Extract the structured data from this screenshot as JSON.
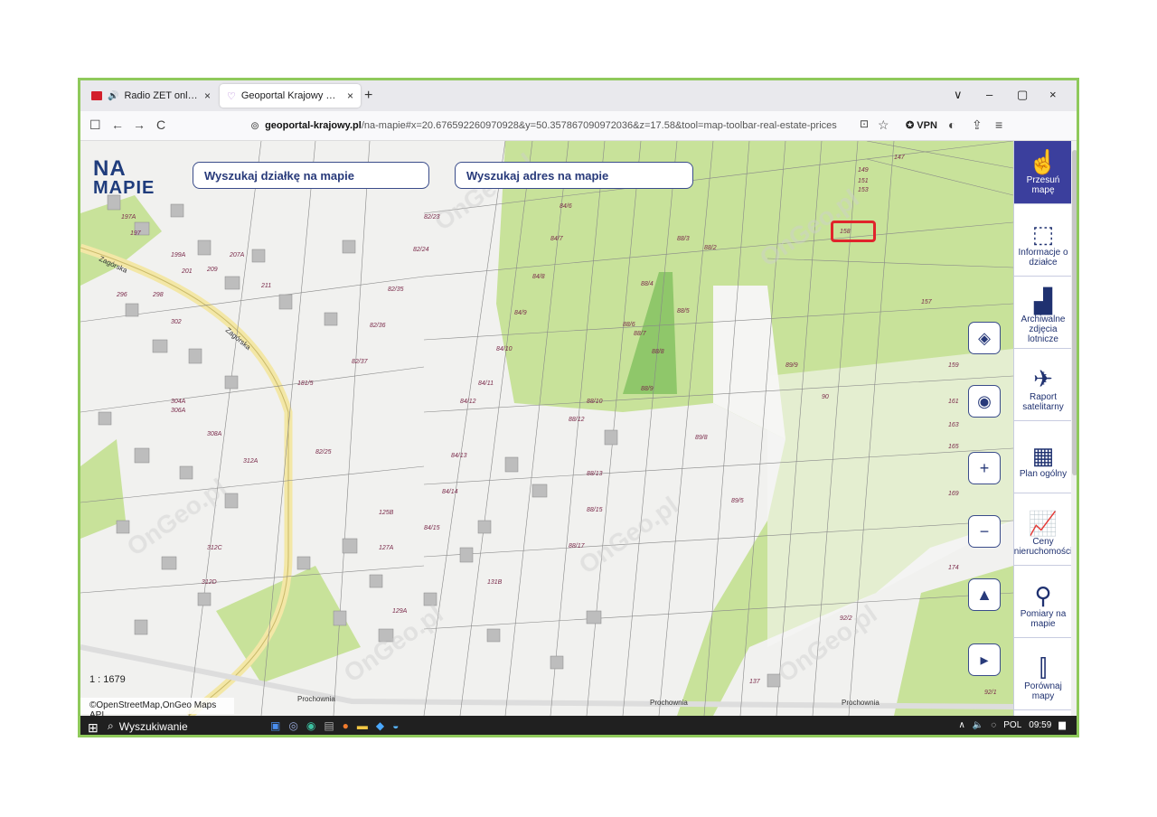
{
  "browser": {
    "tabs": [
      {
        "title": "Radio ZET online - muzyczn",
        "close": "×"
      },
      {
        "title": "Geoportal Krajowy mapy i infor",
        "close": "×"
      }
    ],
    "new_tab": "+",
    "window_controls": [
      "∨",
      "–",
      "▢",
      "×"
    ],
    "nav_icons": [
      "☐",
      "←",
      "→",
      "C"
    ],
    "url_domain": "geoportal-krajowy.pl",
    "url_path": "/na-mapie#x=20.676592260970928&y=50.357867090972036&z=17.58&tool=map-toolbar-real-estate-prices",
    "vpn": "VPN",
    "menu_icon": "≡"
  },
  "map": {
    "logo_line1": "NA",
    "logo_line2": "MAPIE",
    "search_parcel": "Wyszukaj działkę na mapie",
    "search_address": "Wyszukaj adres na mapie",
    "scale": "1 : 1679",
    "attribution": "©OpenStreetMap,OnGeo Maps API",
    "watermark": "OnGeo.pl",
    "highlighted_parcel": "158",
    "controls": [
      "◈",
      "◉",
      "+",
      "−",
      "▲",
      "▸"
    ],
    "colors": {
      "green": "#c8e29a",
      "dark_green": "#8fc76a",
      "highlight": "#e0242b",
      "road": "#f3e7a6"
    },
    "parcel_labels": [
      {
        "t": "158"
      },
      {
        "t": "157"
      },
      {
        "t": "159"
      },
      {
        "t": "161"
      },
      {
        "t": "163"
      },
      {
        "t": "165"
      },
      {
        "t": "169"
      },
      {
        "t": "174"
      },
      {
        "t": "147"
      },
      {
        "t": "149"
      },
      {
        "t": "151"
      },
      {
        "t": "153"
      },
      {
        "t": "89/8"
      },
      {
        "t": "89/9"
      },
      {
        "t": "89/5"
      },
      {
        "t": "88/3"
      },
      {
        "t": "88/2"
      },
      {
        "t": "88/4"
      },
      {
        "t": "88/5"
      },
      {
        "t": "88/6"
      },
      {
        "t": "88/7"
      },
      {
        "t": "88/8"
      },
      {
        "t": "88/9"
      },
      {
        "t": "88/10"
      },
      {
        "t": "88/12"
      },
      {
        "t": "88/13"
      },
      {
        "t": "88/15"
      },
      {
        "t": "88/17"
      },
      {
        "t": "84/6"
      },
      {
        "t": "84/7"
      },
      {
        "t": "84/8"
      },
      {
        "t": "84/9"
      },
      {
        "t": "84/10"
      },
      {
        "t": "84/11"
      },
      {
        "t": "84/12"
      },
      {
        "t": "84/13"
      },
      {
        "t": "84/14"
      },
      {
        "t": "84/15"
      },
      {
        "t": "82/23"
      },
      {
        "t": "82/24"
      },
      {
        "t": "82/35"
      },
      {
        "t": "82/36"
      },
      {
        "t": "82/37"
      },
      {
        "t": "82/25"
      },
      {
        "t": "181/5"
      },
      {
        "t": "125B"
      },
      {
        "t": "127A"
      },
      {
        "t": "129A"
      },
      {
        "t": "131B"
      },
      {
        "t": "306A"
      },
      {
        "t": "308A"
      },
      {
        "t": "312A"
      },
      {
        "t": "312C"
      },
      {
        "t": "312D"
      },
      {
        "t": "197"
      },
      {
        "t": "197A"
      },
      {
        "t": "199A"
      },
      {
        "t": "201"
      },
      {
        "t": "207A"
      },
      {
        "t": "209"
      },
      {
        "t": "211"
      },
      {
        "t": "296"
      },
      {
        "t": "298"
      },
      {
        "t": "302"
      },
      {
        "t": "304A"
      },
      {
        "t": "137"
      },
      {
        "t": "92/2"
      },
      {
        "t": "90"
      },
      {
        "t": "92/1"
      }
    ],
    "street_labels": [
      "Zagórska",
      "Zagórska",
      "Prochownia",
      "Prochownia",
      "Prochownia"
    ]
  },
  "toolbar": {
    "items": [
      {
        "label": "Przesuń mapę",
        "icon": "hand-icon",
        "glyph": "☝"
      },
      {
        "label": "Informacje o działce",
        "icon": "parcel-info-icon",
        "glyph": "⬚"
      },
      {
        "label": "Archiwalne zdjęcia lotnicze",
        "icon": "aerial-photo-icon",
        "glyph": "▟"
      },
      {
        "label": "Raport satelitarny",
        "icon": "satellite-icon",
        "glyph": "✈"
      },
      {
        "label": "Plan ogólny",
        "icon": "general-plan-icon",
        "glyph": "▦"
      },
      {
        "label": "Ceny nieruchomości",
        "icon": "price-chart-icon",
        "glyph": "📈"
      },
      {
        "label": "Pomiary na mapie",
        "icon": "measure-icon",
        "glyph": "⚲"
      },
      {
        "label": "Porównaj mapy",
        "icon": "compare-icon",
        "glyph": "⫿"
      }
    ]
  },
  "taskbar": {
    "search": "Wyszukiwanie",
    "lang": "POL",
    "time": "09:59"
  }
}
